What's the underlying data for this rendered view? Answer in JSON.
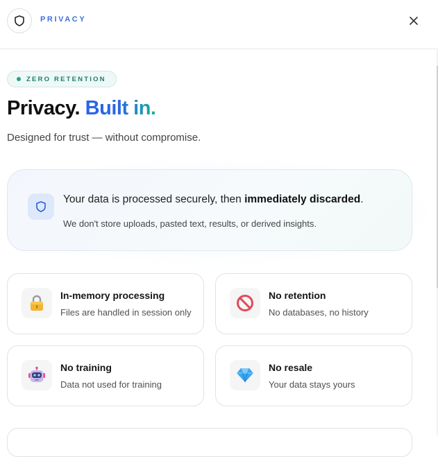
{
  "header": {
    "title": "PRIVACY",
    "shield_icon": "shield-icon",
    "close_icon": "close-icon"
  },
  "badge": {
    "label": "ZERO RETENTION",
    "dot_color": "#22a37f"
  },
  "hero": {
    "title_part1": "Privacy.",
    "title_part2": "Built in.",
    "subtitle": "Designed for trust — without compromise."
  },
  "notice": {
    "icon": "shield-icon",
    "text_prefix": "Your data is processed securely, then ",
    "text_bold": "immediately discarded",
    "text_suffix": ".",
    "subtext": "We don't store uploads, pasted text, results, or derived insights."
  },
  "features": [
    {
      "icon": "lock-icon",
      "title": "In-memory processing",
      "subtitle": "Files are handled in session only"
    },
    {
      "icon": "no-entry-icon",
      "title": "No retention",
      "subtitle": "No databases, no history"
    },
    {
      "icon": "robot-icon",
      "title": "No training",
      "subtitle": "Data not used for training"
    },
    {
      "icon": "gem-icon",
      "title": "No resale",
      "subtitle": "Your data stays yours"
    }
  ],
  "colors": {
    "accent_blue": "#3f6fe0",
    "accent_teal": "#17b29a"
  }
}
